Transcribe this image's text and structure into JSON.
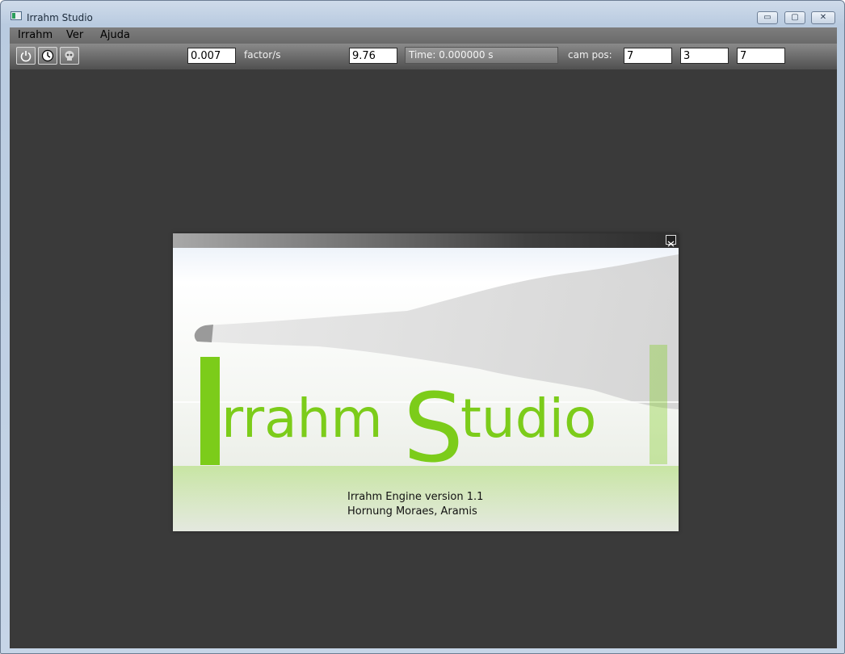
{
  "window": {
    "title": "Irrahm Studio",
    "minimize_glyph": "▭",
    "maximize_glyph": "▢",
    "close_glyph": "✕"
  },
  "menu": {
    "items": [
      "Irrahm",
      "Ver",
      "Ajuda"
    ]
  },
  "toolbar": {
    "buttons": [
      {
        "icon": "power-icon"
      },
      {
        "icon": "clock-icon"
      },
      {
        "icon": "skull-icon"
      }
    ],
    "factor_value": "0.007",
    "factor_label": "factor/s",
    "second_value": "9.76",
    "time_text": "Time: 0.000000 s",
    "cam_label": "cam pos:",
    "cam_x": "7",
    "cam_y": "3",
    "cam_z": "7"
  },
  "splash": {
    "logo_text": "Irrahm Studio",
    "logo_color": "#7ccc1a",
    "version_text": "Irrahm Engine version 1.1",
    "author_text": "Hornung Moraes, Aramis"
  }
}
